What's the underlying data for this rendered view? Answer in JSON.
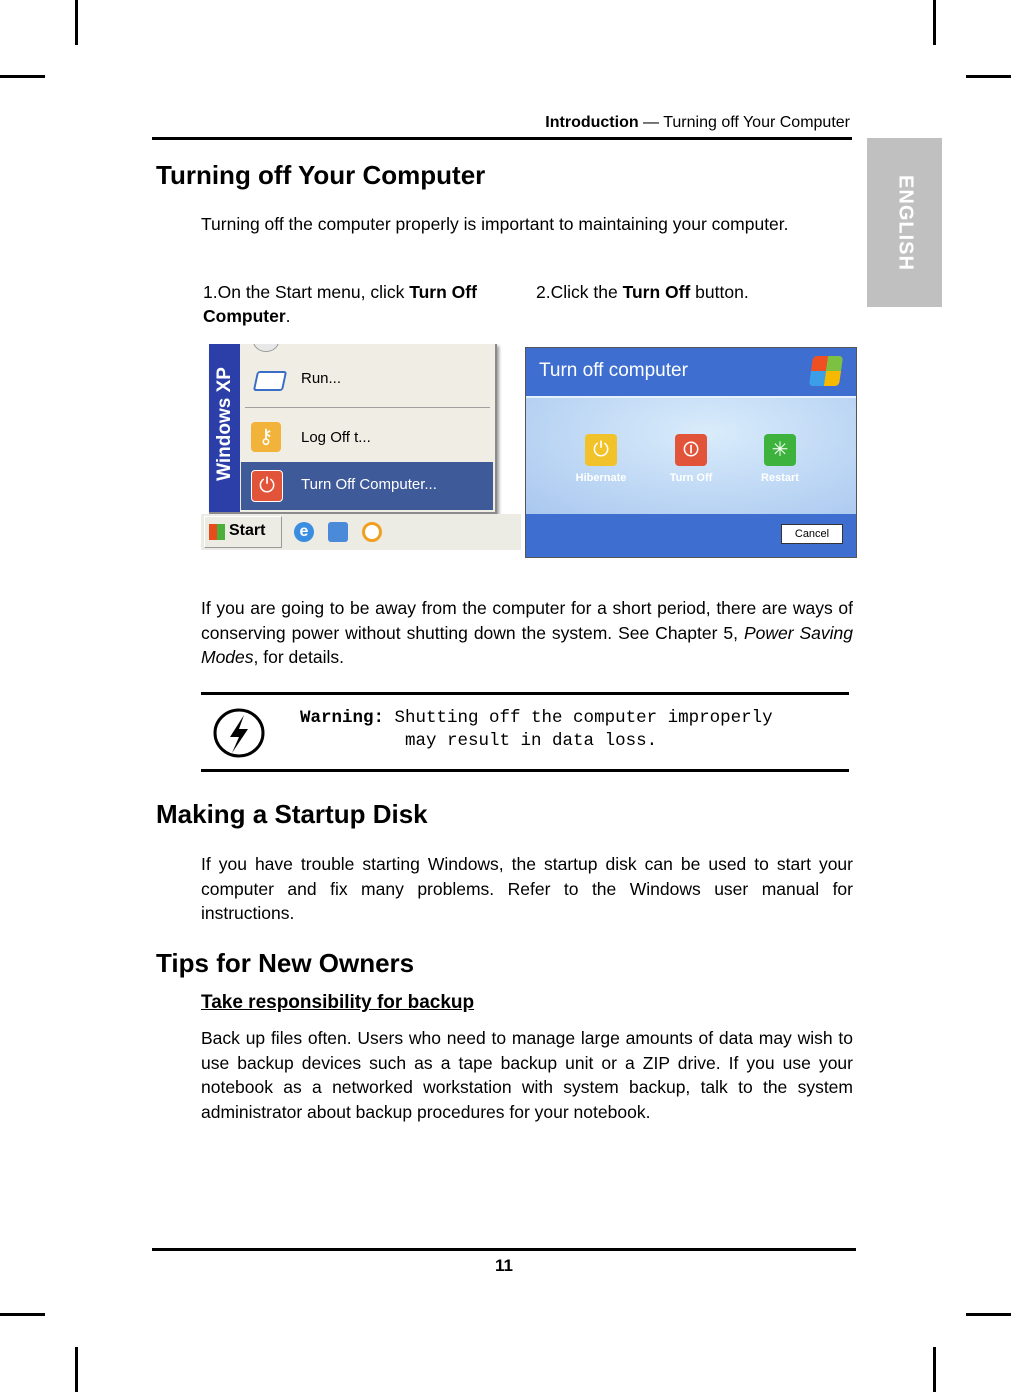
{
  "header": {
    "section": "Introduction",
    "separator": " — ",
    "topic": "Turning off Your Computer"
  },
  "language_tab": "ENGLISH",
  "sections": {
    "turn_off": {
      "title": "Turning off Your Computer",
      "intro": "Turning off the computer properly is important to maintaining your computer.",
      "step1": {
        "num": "1.",
        "pre": "On the Start menu, click ",
        "bold": "Turn Off Computer",
        "post": "."
      },
      "step2": {
        "num": "2.",
        "pre": "Click the ",
        "bold": "Turn Off",
        "post": " button."
      },
      "note_pre": "If you are going to be away from the computer for a short period, there are ways of conserving power without shutting down the system. See Chapter 5, ",
      "note_italic": "Power Saving Modes",
      "note_post": ", for details."
    },
    "warning": {
      "label": "Warning:",
      "line1": "Shutting off the computer improperly",
      "line2": "may result in data loss."
    },
    "startup": {
      "title": "Making a Startup Disk",
      "body": "If you have trouble starting Windows, the startup disk can be used to start your computer and fix many problems. Refer to the Windows user manual for instructions."
    },
    "tips": {
      "title": "Tips for New Owners",
      "subtitle": "Take responsibility for backup",
      "body": "Back up files often. Users who need to manage large amounts of data may wish to use backup devices such as a tape backup unit or a ZIP drive. If you use your notebook as a networked workstation with system backup, talk to the system administrator about backup procedures for your notebook."
    }
  },
  "start_menu_screenshot": {
    "side_banner": "Windows XP",
    "items": [
      "Run...",
      "Log Off t...",
      "Turn Off Computer..."
    ],
    "start_label": "Start"
  },
  "turn_off_dialog": {
    "title": "Turn off computer",
    "buttons": [
      "Hibernate",
      "Turn Off",
      "Restart"
    ],
    "cancel": "Cancel",
    "colors": {
      "title_bar": "#3d6ed0",
      "body": "#c3dcf7",
      "hibernate": "#f2c22a",
      "turn_off": "#e2543a",
      "restart": "#3db33d",
      "menu_highlight": "#3e5a99"
    }
  },
  "page_number": "11"
}
